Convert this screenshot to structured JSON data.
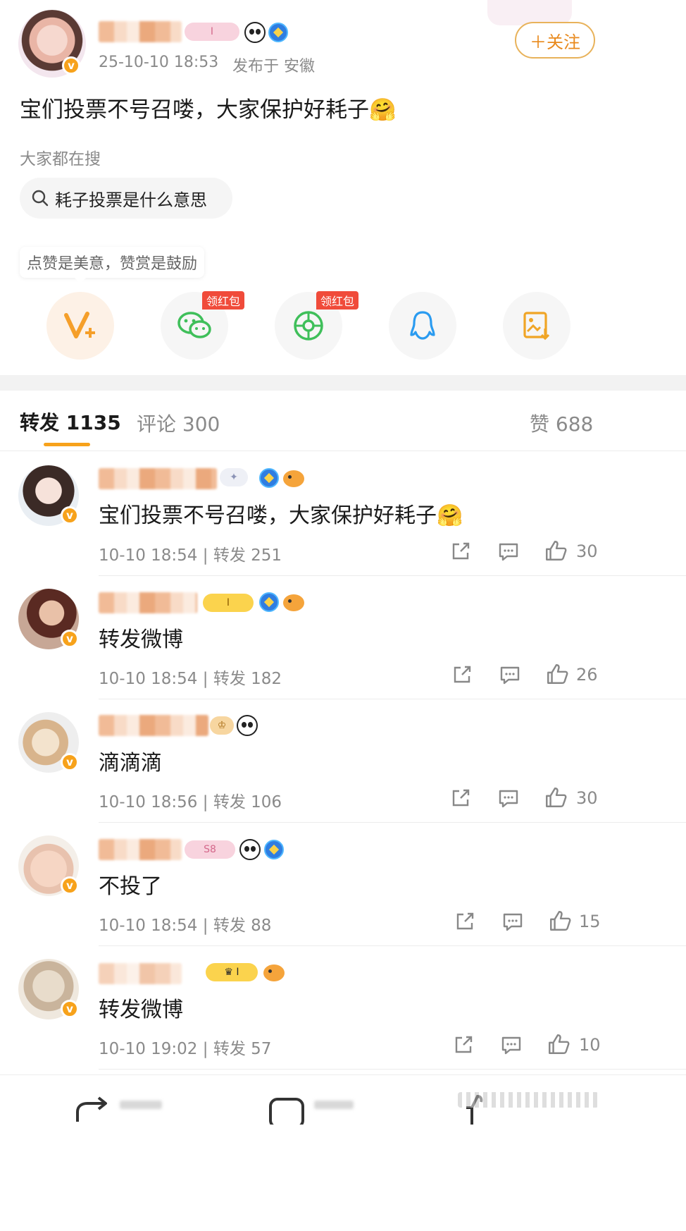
{
  "post": {
    "time": "25-10-10 18:53",
    "location": "发布于 安徽",
    "follow_label": "＋关注",
    "text": "宝们投票不号召喽，大家保护好耗子",
    "emoji": "🤗"
  },
  "search": {
    "heading": "大家都在搜",
    "query": "耗子投票是什么意思"
  },
  "reward": {
    "tip": "点赞是美意，赞赏是鼓励",
    "hongbao_label": "领红包"
  },
  "share_icons": [
    "v-plus-icon",
    "wechat-icon",
    "moments-icon",
    "qq-icon",
    "save-image-icon"
  ],
  "tabs": {
    "repost_label": "转发",
    "repost_count": "1135",
    "comment_label": "评论",
    "comment_count": "300",
    "like_label": "赞",
    "like_count": "688"
  },
  "reposts": [
    {
      "text": "宝们投票不号召喽，大家保护好耗子",
      "emoji": "🤗",
      "time": "10-10 18:54",
      "repost": "转发 251",
      "likes": "30"
    },
    {
      "text": "转发微博",
      "emoji": "",
      "time": "10-10 18:54",
      "repost": "转发 182",
      "likes": "26"
    },
    {
      "text": "滴滴滴",
      "emoji": "",
      "time": "10-10 18:56",
      "repost": "转发 106",
      "likes": "30"
    },
    {
      "text": "不投了",
      "emoji": "",
      "time": "10-10 18:54",
      "repost": "转发 88",
      "likes": "15"
    },
    {
      "text": "转发微博",
      "emoji": "",
      "time": "10-10 19:02",
      "repost": "转发 57",
      "likes": "10"
    }
  ],
  "colors": {
    "accent": "#f7a21b",
    "follow": "#e8891c",
    "hongbao": "#f04b3a",
    "tab_indicator": "#f7a21b"
  }
}
